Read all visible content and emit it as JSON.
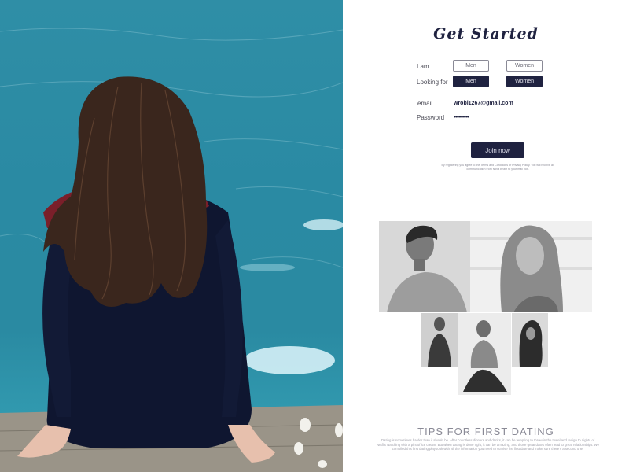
{
  "form": {
    "title": "Get Started",
    "iam_label": "I am",
    "looking_label": "Looking for",
    "iam_options": [
      "Men",
      "Women"
    ],
    "looking_options": [
      "Men",
      "Women"
    ],
    "email_label": "email",
    "email_value": "wrobi1267@gmail.com",
    "password_label": "Password",
    "password_value": "••••••••••",
    "join_label": "Join now",
    "terms_text": "By registering you agree to the Terms and Conditions or Privacy Policy. You will receive all communication from Nova Brizm to your mail box."
  },
  "tips": {
    "title": "TIPS FOR FIRST DATING",
    "body": "Dating is sometimes harder than it should be. After countless dinners and drinks, it can be tempting to throw in the towel and resign to nights of Netflix watching with a pint of ice cream. But when dating is done right, it can be amazing, and those great dates often lead to great relationships. We compiled this first dating playbook with all the information you need to survive the first date and make sure there's a second one."
  },
  "colors": {
    "accent": "#1f2240",
    "water": "#2a8aa3"
  }
}
